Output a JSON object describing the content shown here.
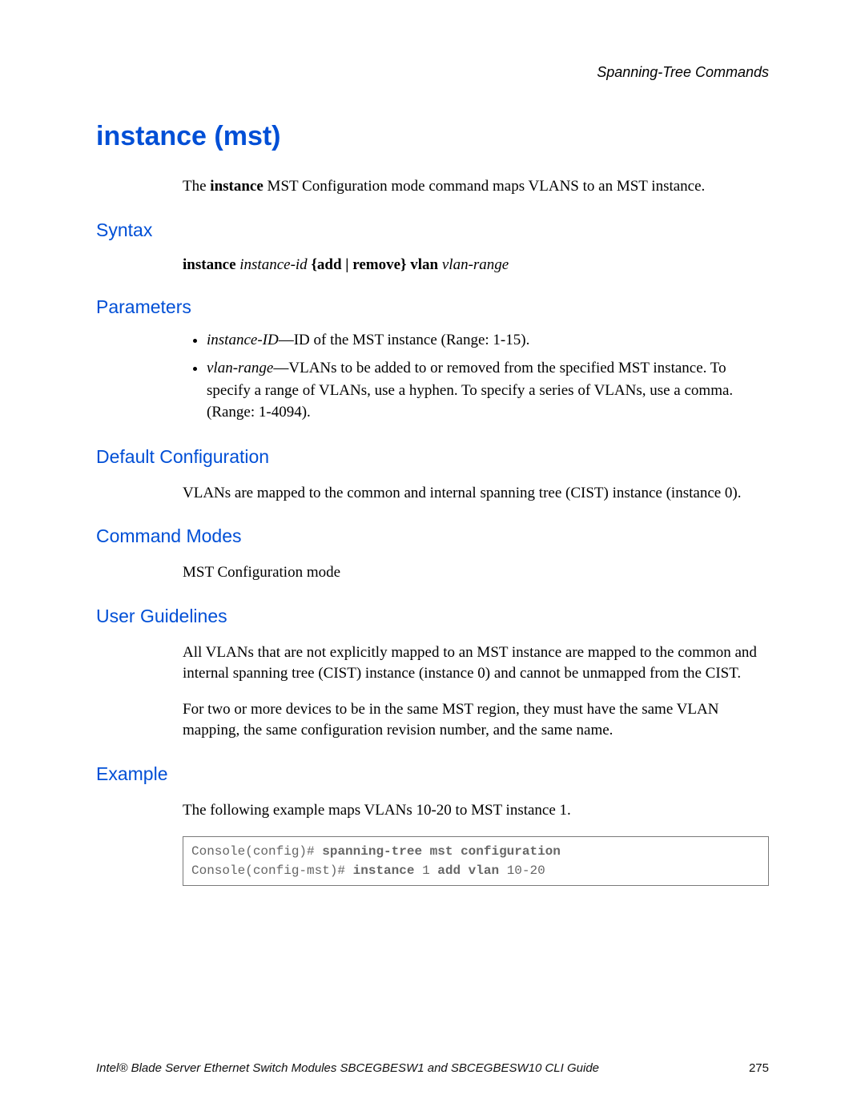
{
  "header": {
    "section": "Spanning-Tree Commands"
  },
  "title": "instance (mst)",
  "intro_prefix": "The ",
  "intro_bold": "instance",
  "intro_rest": " MST Configuration mode command maps VLANS to an MST instance.",
  "sections": {
    "syntax": "Syntax",
    "parameters": "Parameters",
    "default_config": "Default Configuration",
    "command_modes": "Command Modes",
    "user_guidelines": "User Guidelines",
    "example": "Example"
  },
  "syntax_line": {
    "kw1": "instance",
    "arg1": " instance-id ",
    "kw2": "{add | remove} vlan",
    "arg2": " vlan-range"
  },
  "params": {
    "p1_term": "instance-ID",
    "p1_desc": "—ID of the MST instance (Range: 1-15).",
    "p2_term": "vlan-range",
    "p2_desc": "—VLANs to be added to or removed from the specified MST instance. To specify a range of VLANs, use a hyphen. To specify a series of VLANs, use a comma. (Range: 1-4094)."
  },
  "default_config_text": "VLANs are mapped to the common and internal spanning tree (CIST) instance (instance 0).",
  "command_modes_text": "MST Configuration mode",
  "user_guidelines_p1": "All VLANs that are not explicitly mapped to an MST instance are mapped to the common and internal spanning tree (CIST) instance (instance 0) and cannot be unmapped from the CIST.",
  "user_guidelines_p2": "For two or more devices to be in the same MST region, they must have the same VLAN mapping, the same configuration revision number, and the same name.",
  "example_text": "The following example maps VLANs 10-20 to MST instance 1.",
  "code": {
    "l1_prompt": "Console(config)# ",
    "l1_bold": "spanning-tree mst configuration",
    "l2_prompt": "Console(config-mst)# ",
    "l2_bold1": "instance ",
    "l2_mid": "1 ",
    "l2_bold2": "add vlan ",
    "l2_end": "10-20"
  },
  "footer": {
    "text": "Intel® Blade Server Ethernet Switch Modules SBCEGBESW1 and SBCEGBESW10 CLI Guide",
    "page": "275"
  }
}
